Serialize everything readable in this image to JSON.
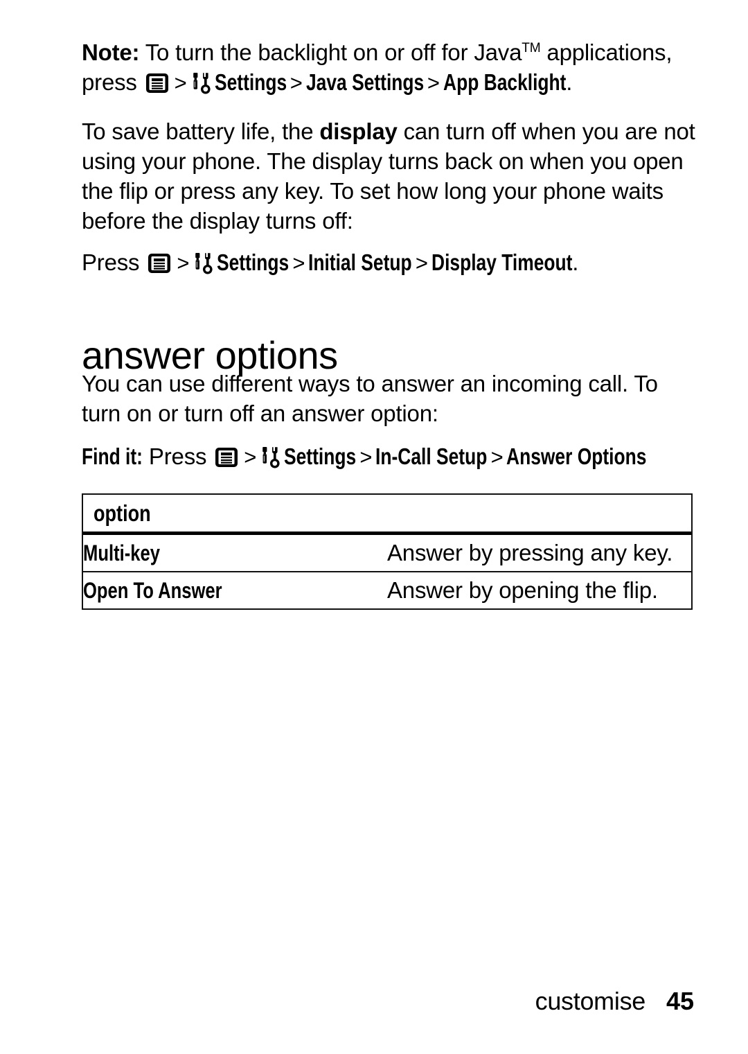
{
  "document": {
    "note": {
      "label": "Note:",
      "line1_text": " To turn the backlight on or off for Java",
      "trademark": "TM",
      "line1_tail": " applications,",
      "line2_prefix": "press ",
      "menu_icon": "menu-key-icon",
      "separator": ">",
      "tools_icon": "settings-tools-icon",
      "path": [
        "Settings",
        "Java Settings",
        "App Backlight"
      ],
      "period": "."
    },
    "paragraph1": "To save battery life, the display can turn off when you are not using your phone. The display turns back on when you open the flip or press any key. To set how long your phone waits before the display turns off:",
    "paragraph1_parts": {
      "p1": "To save battery life, the ",
      "bold": "display",
      "p2": " can turn off when you are not using your phone. The display turns back on when you open the flip or press any key. To set how long your phone waits before the display turns off:"
    },
    "press_line": {
      "prefix": "Press ",
      "menu_icon": "menu-key-icon",
      "separator": ">",
      "tools_icon": "settings-tools-icon",
      "path": [
        "Settings",
        "Initial Setup",
        "Display Timeout"
      ],
      "period": "."
    },
    "heading": "answer options",
    "paragraph2": "You can use different ways to answer an incoming call. To turn on or turn off an answer option:",
    "find_it": {
      "label": "Find it:",
      "prefix": " Press ",
      "menu_icon": "menu-key-icon",
      "separator": ">",
      "tools_icon": "settings-tools-icon",
      "path": [
        "Settings",
        "In-Call Setup",
        "Answer Options"
      ]
    },
    "table": {
      "header": "option",
      "rows": [
        {
          "option": "Multi-key",
          "description": "Answer by pressing any key."
        },
        {
          "option": "Open To Answer",
          "description": "Answer by opening the flip."
        }
      ]
    },
    "footer": {
      "section": "customise",
      "page_number": "45"
    }
  }
}
